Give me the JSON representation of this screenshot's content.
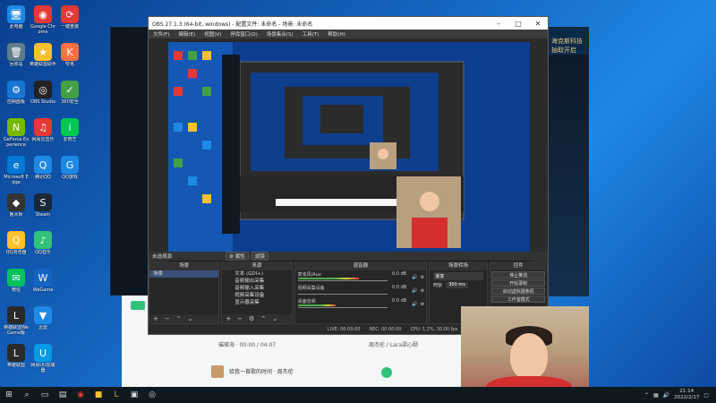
{
  "desktop_icons": [
    {
      "id": "this-pc",
      "label": "此电脑",
      "glyph": "🖥",
      "color": "#1e88e5"
    },
    {
      "id": "recycle-bin",
      "label": "回收站",
      "glyph": "🗑",
      "color": "#607d8b"
    },
    {
      "id": "control-panel",
      "label": "控制面板",
      "glyph": "⚙",
      "color": "#1976d2"
    },
    {
      "id": "geforce",
      "label": "GeForce Experience",
      "glyph": "N",
      "color": "#76b900"
    },
    {
      "id": "edge",
      "label": "Microsoft Edge",
      "glyph": "e",
      "color": "#0078d4"
    },
    {
      "id": "ludashi",
      "label": "鲁大师",
      "glyph": "◆",
      "color": "#333"
    },
    {
      "id": "qiezi",
      "label": "QQ浏览器",
      "glyph": "Q",
      "color": "#fbc02d"
    },
    {
      "id": "wechat",
      "label": "微信",
      "glyph": "✉",
      "color": "#07c160"
    },
    {
      "id": "lol",
      "label": "英雄联盟WeGame版",
      "glyph": "L",
      "color": "#2a2a2a"
    },
    {
      "id": "lol2",
      "label": "英雄联盟",
      "glyph": "L",
      "color": "#2a2a2a"
    },
    {
      "id": "chrome",
      "label": "Google Chrome",
      "glyph": "◉",
      "color": "#e53935"
    },
    {
      "id": "lol-helper",
      "label": "英雄联盟助手",
      "glyph": "★",
      "color": "#fbc02d"
    },
    {
      "id": "obs",
      "label": "OBS Studio",
      "glyph": "◎",
      "color": "#222"
    },
    {
      "id": "netease",
      "label": "网易云音乐",
      "glyph": "♫",
      "color": "#e53935"
    },
    {
      "id": "qq",
      "label": "腾讯QQ",
      "glyph": "Q",
      "color": "#1e88e5"
    },
    {
      "id": "steam",
      "label": "Steam",
      "glyph": "S",
      "color": "#1b2838"
    },
    {
      "id": "music-tool",
      "label": "QQ音乐",
      "glyph": "♪",
      "color": "#31c27c"
    },
    {
      "id": "wegame",
      "label": "WeGame",
      "glyph": "W",
      "color": "#1565c0"
    },
    {
      "id": "kk",
      "label": "迅雷",
      "glyph": "▼",
      "color": "#1e88e5"
    },
    {
      "id": "xunlei",
      "label": "网易UU加速器",
      "glyph": "U",
      "color": "#039be5"
    },
    {
      "id": "app-a",
      "label": "一键重装",
      "glyph": "⟳",
      "color": "#e53935"
    },
    {
      "id": "app-b",
      "label": "夸克",
      "glyph": "K",
      "color": "#ff7043"
    },
    {
      "id": "app-c",
      "label": "360安全",
      "glyph": "✓",
      "color": "#43a047"
    },
    {
      "id": "app-d",
      "label": "爱奇艺",
      "glyph": "i",
      "color": "#00c853"
    },
    {
      "id": "app-e",
      "label": "QQ游戏",
      "glyph": "G",
      "color": "#1e88e5"
    }
  ],
  "obs": {
    "title": "OBS 27.1.3 (64-bit, windows) - 配置文件: 未命名 - 场景: 未命名",
    "menu": [
      "文件(F)",
      "编辑(E)",
      "视图(V)",
      "停靠窗口(D)",
      "场景集合(S)",
      "工具(T)",
      "帮助(H)"
    ],
    "scene_label": "未选择源",
    "ctrl_props": "⚙ 属性",
    "ctrl_filters": "滤镜",
    "docks": {
      "scenes": {
        "title": "场景",
        "items": [
          "场景"
        ]
      },
      "sources": {
        "title": "来源",
        "items": [
          "文本 (GDI+)",
          "音频输出采集",
          "音频输入采集",
          "视频采集设备",
          "显示器采集"
        ]
      },
      "mixer": {
        "title": "混音器",
        "channels": [
          {
            "name": "麦克风/Aux",
            "db": "0.0 dB",
            "level": 0.68
          },
          {
            "name": "视频采集设备",
            "db": "0.0 dB",
            "level": 0.0
          },
          {
            "name": "桌面音频",
            "db": "0.0 dB",
            "level": 0.42
          }
        ]
      },
      "transitions": {
        "title": "场景转场",
        "type": "渐变",
        "duration_label": "时长",
        "duration": "300 ms"
      },
      "controls": {
        "title": "控件",
        "buttons": [
          "停止推流",
          "开始录制",
          "启动虚拟摄像机",
          "工作室模式"
        ]
      }
    },
    "status": [
      "LIVE: 00:00:00",
      "REC: 00:00:00",
      "CPU: 1.2%, 30.00 fps"
    ]
  },
  "launcher": {
    "banner": "海克斯科技",
    "sub": "抽取开启"
  },
  "music": {
    "song_line": "璀璨海 · 00:00 / 04:07",
    "artist_line": "周杰伦 / Lara梁心颐",
    "track_title": "给我一首歌的时间 · 周杰伦"
  },
  "taskbar": {
    "time": "21:14",
    "date": "2022/2/17"
  }
}
